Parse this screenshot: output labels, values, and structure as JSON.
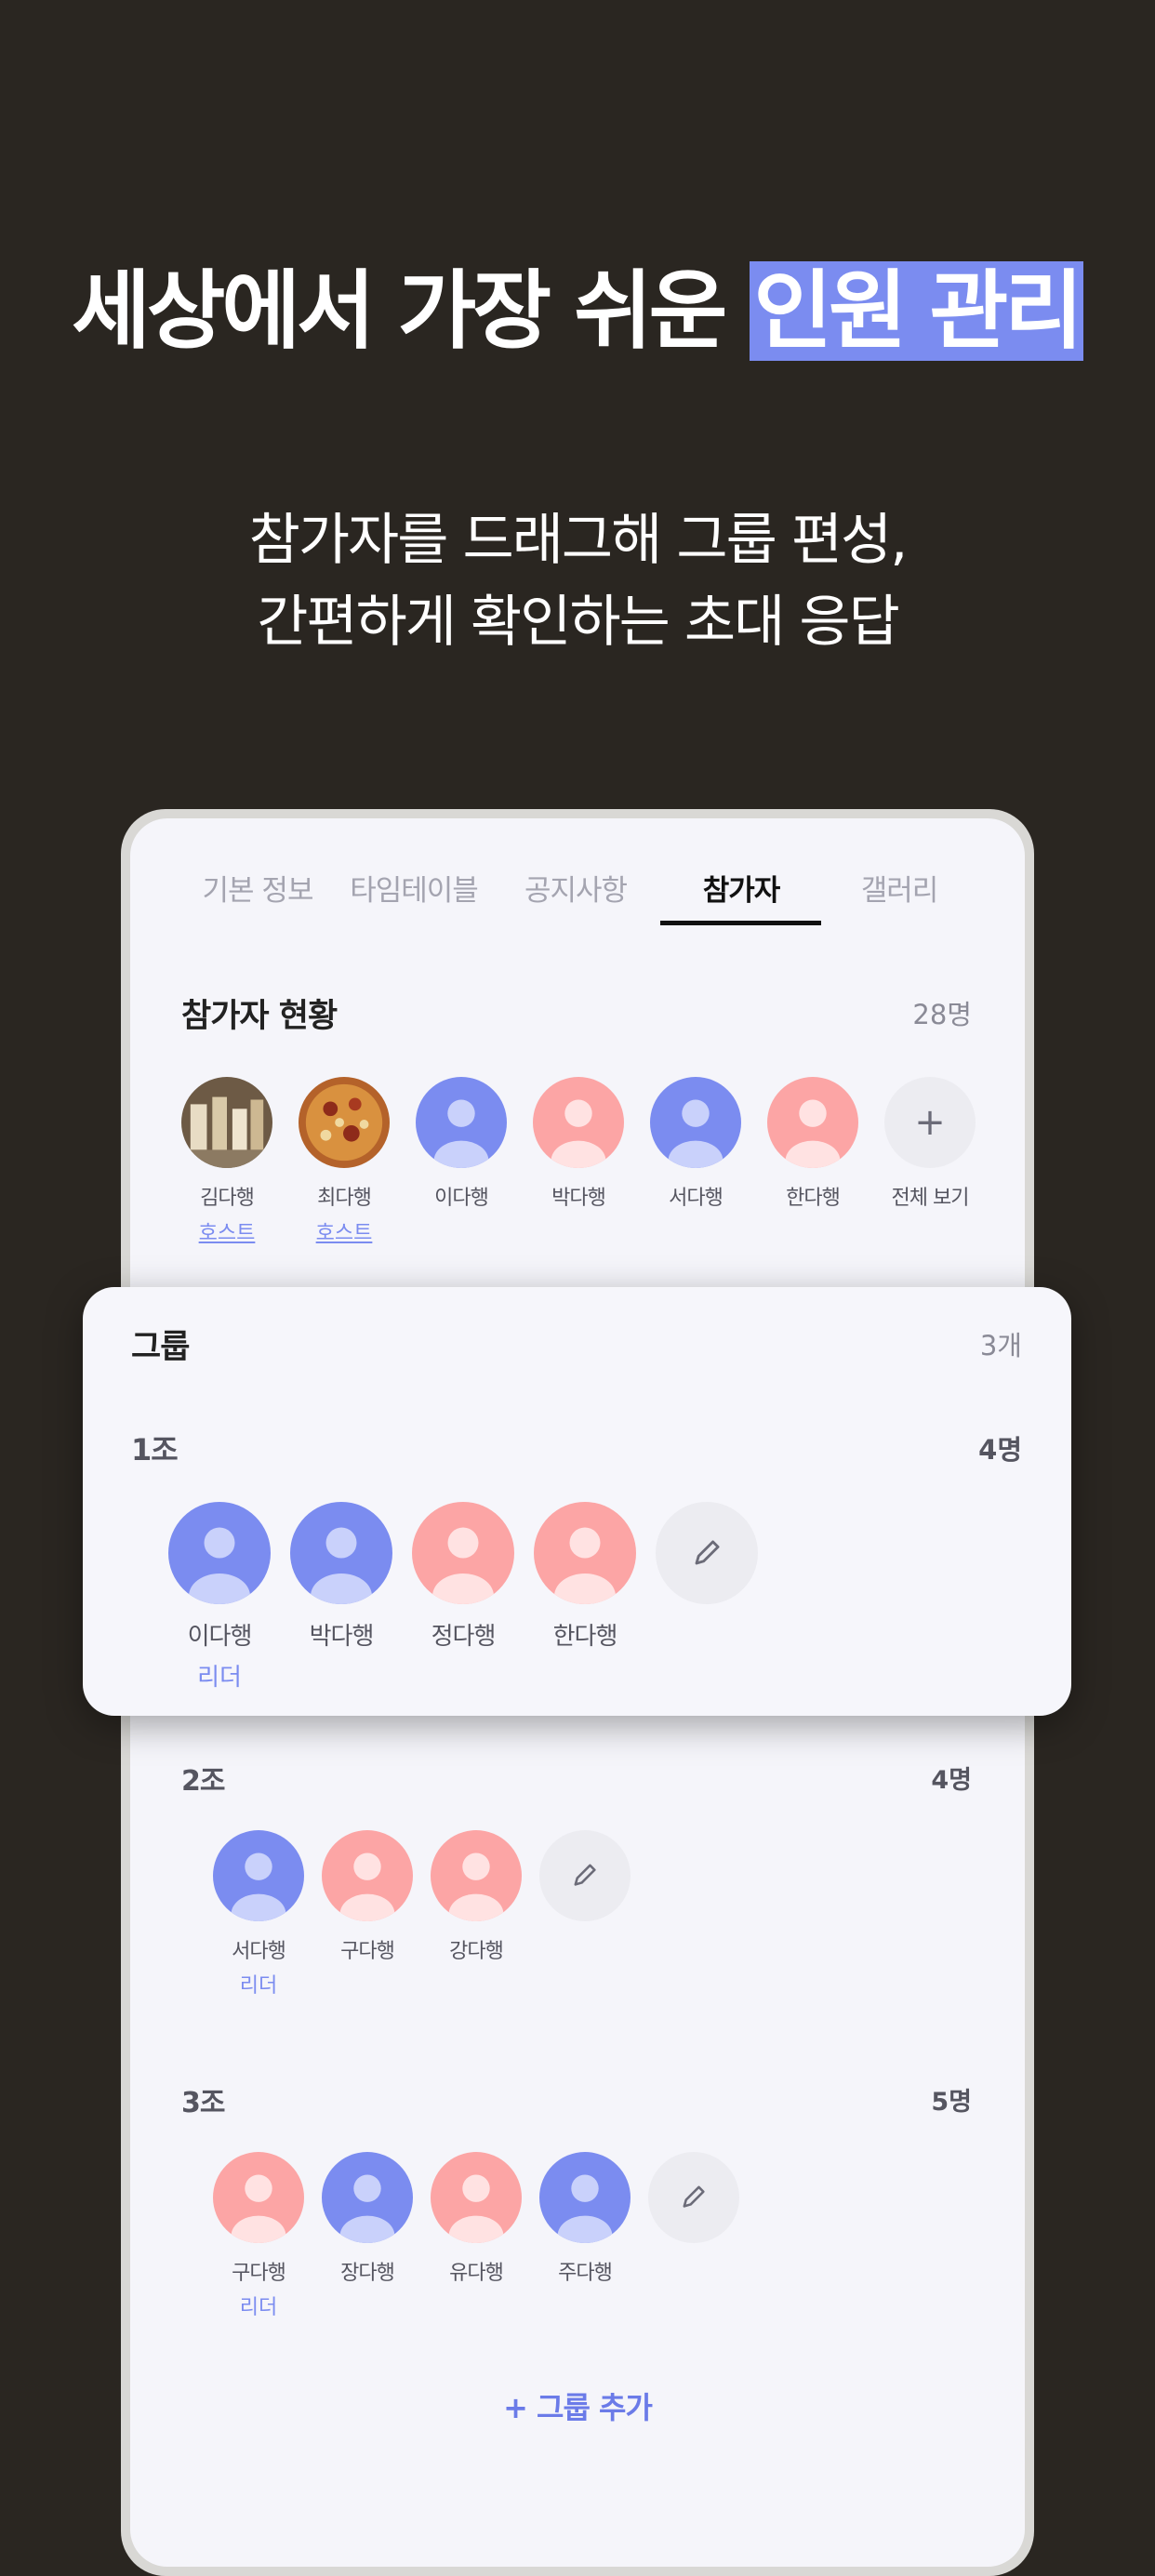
{
  "headline": {
    "prefix": "세상에서 가장 쉬운 ",
    "highlight": "인원 관리"
  },
  "subtitle": {
    "line1": "참가자를 드래그해 그룹 편성,",
    "line2": "간편하게 확인하는 초대 응답"
  },
  "colors": {
    "background": "#2a2621",
    "accent": "#7b8cf0",
    "avatar_blue": "#7b8cf0",
    "avatar_pink": "#fca5a5",
    "leader": "#7b8cf0"
  },
  "tabs": [
    {
      "label": "기본 정보",
      "active": false
    },
    {
      "label": "타임테이블",
      "active": false
    },
    {
      "label": "공지사항",
      "active": false
    },
    {
      "label": "참가자",
      "active": true
    },
    {
      "label": "갤러리",
      "active": false
    }
  ],
  "participants": {
    "title": "참가자 현황",
    "count": "28명",
    "people": [
      {
        "name": "김다행",
        "badge": "호스트",
        "avatar": "photo-drinks"
      },
      {
        "name": "최다행",
        "badge": "호스트",
        "avatar": "photo-pizza"
      },
      {
        "name": "이다행",
        "avatar": "person-blue"
      },
      {
        "name": "박다행",
        "avatar": "person-pink"
      },
      {
        "name": "서다행",
        "avatar": "person-blue"
      },
      {
        "name": "한다행",
        "avatar": "person-pink"
      }
    ],
    "view_all_label": "전체 보기",
    "view_all_icon": "plus-icon"
  },
  "groups": {
    "title": "그룹",
    "count": "3개",
    "edit_icon": "pencil-icon",
    "list": [
      {
        "name": "1조",
        "count": "4명",
        "leader_label": "리더",
        "members": [
          {
            "name": "이다행",
            "color": "blue",
            "leader": true
          },
          {
            "name": "박다행",
            "color": "blue",
            "leader": false
          },
          {
            "name": "정다행",
            "color": "pink",
            "leader": false
          },
          {
            "name": "한다행",
            "color": "pink",
            "leader": false
          }
        ]
      },
      {
        "name": "2조",
        "count": "4명",
        "leader_label": "리더",
        "members": [
          {
            "name": "서다행",
            "color": "blue",
            "leader": true
          },
          {
            "name": "구다행",
            "color": "pink",
            "leader": false
          },
          {
            "name": "강다행",
            "color": "pink",
            "leader": false
          }
        ]
      },
      {
        "name": "3조",
        "count": "5명",
        "leader_label": "리더",
        "members": [
          {
            "name": "구다행",
            "color": "pink",
            "leader": true
          },
          {
            "name": "장다행",
            "color": "blue",
            "leader": false
          },
          {
            "name": "유다행",
            "color": "pink",
            "leader": false
          },
          {
            "name": "주다행",
            "color": "blue",
            "leader": false
          }
        ]
      }
    ],
    "add_label": "+ 그룹 추가"
  }
}
